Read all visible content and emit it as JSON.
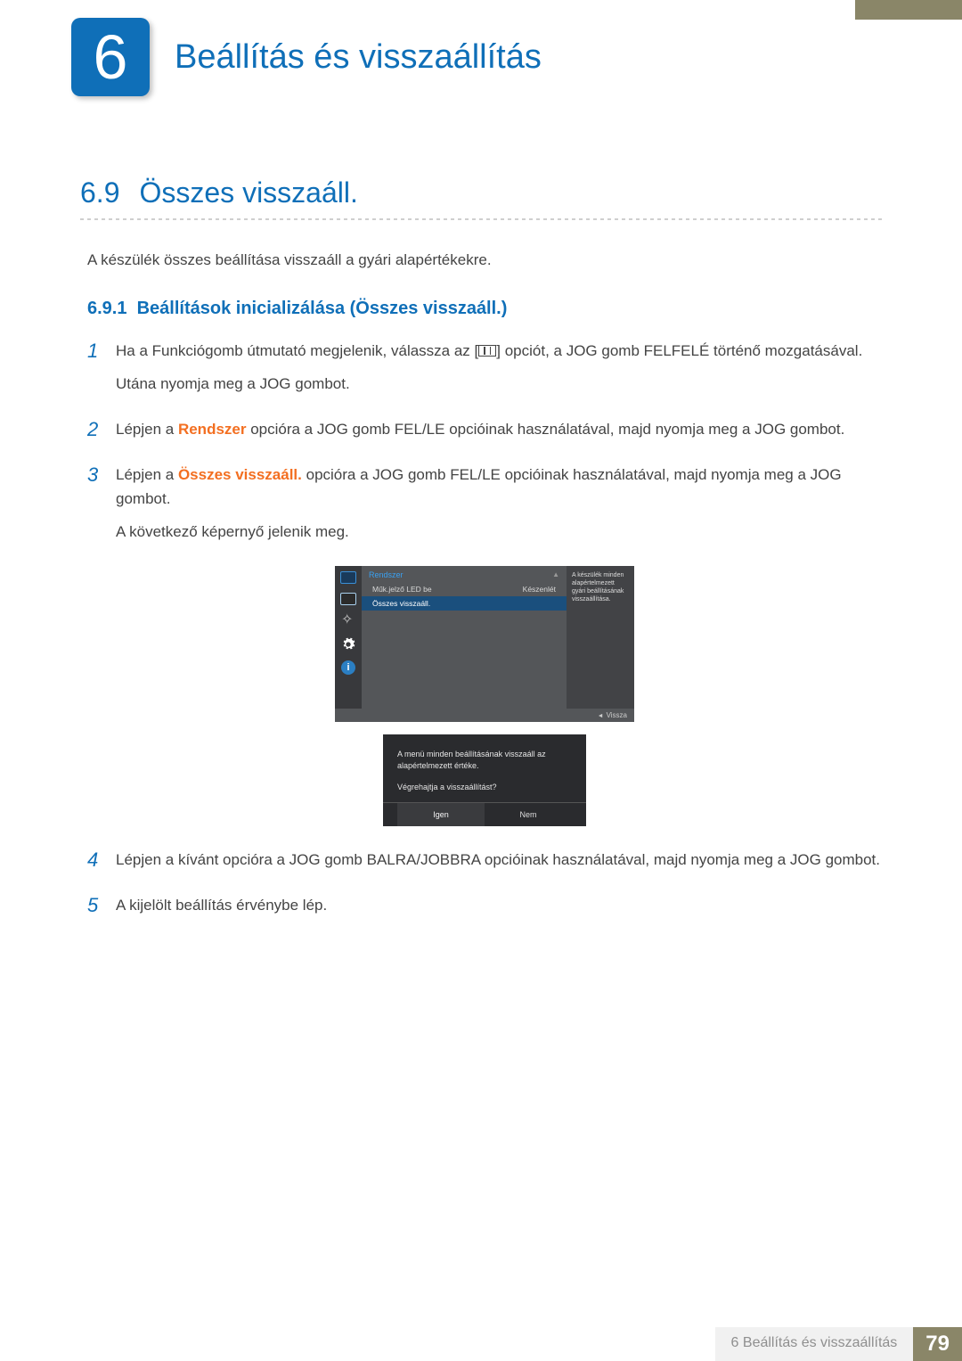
{
  "chapter": {
    "number": "6",
    "title": "Beállítás és visszaállítás"
  },
  "section": {
    "number": "6.9",
    "title": "Összes visszaáll."
  },
  "intro": "A készülék összes beállítása visszaáll a gyári alapértékekre.",
  "subsection": {
    "number": "6.9.1",
    "title": "Beállítások inicializálása (Összes visszaáll.)"
  },
  "steps": {
    "s1": {
      "num": "1",
      "p1a": "Ha a Funkciógomb útmutató megjelenik, válassza az [",
      "p1b": "] opciót, a JOG gomb FELFELÉ történő mozgatásával.",
      "p2": "Utána nyomja meg a JOG gombot."
    },
    "s2": {
      "num": "2",
      "a": "Lépjen a ",
      "kw": "Rendszer",
      "b": " opcióra a JOG gomb FEL/LE opcióinak használatával, majd nyomja meg a JOG gombot."
    },
    "s3": {
      "num": "3",
      "a": "Lépjen a ",
      "kw": "Összes visszaáll.",
      "b": " opcióra a JOG gomb FEL/LE opcióinak használatával, majd nyomja meg a JOG gombot.",
      "p2": "A következő képernyő jelenik meg."
    },
    "s4": {
      "num": "4",
      "text": "Lépjen a kívánt opcióra a JOG gomb BALRA/JOBBRA opcióinak használatával, majd nyomja meg a JOG gombot."
    },
    "s5": {
      "num": "5",
      "text": "A kijelölt beállítás érvénybe lép."
    }
  },
  "osd": {
    "title": "Rendszer",
    "row1": {
      "label": "Műk.jelző LED be",
      "value": "Készenlét"
    },
    "row2": {
      "label": "Összes visszaáll."
    },
    "help": "A készülék minden alapértelmezett gyári beállításának visszaállítása.",
    "back": "Vissza"
  },
  "confirm": {
    "line1": "A menü minden beállításának visszaáll az alapértelmezett értéke.",
    "line2": "Végrehajtja a visszaállítást?",
    "yes": "Igen",
    "no": "Nem"
  },
  "footer": {
    "text": "6 Beállítás és visszaállítás",
    "page": "79"
  }
}
